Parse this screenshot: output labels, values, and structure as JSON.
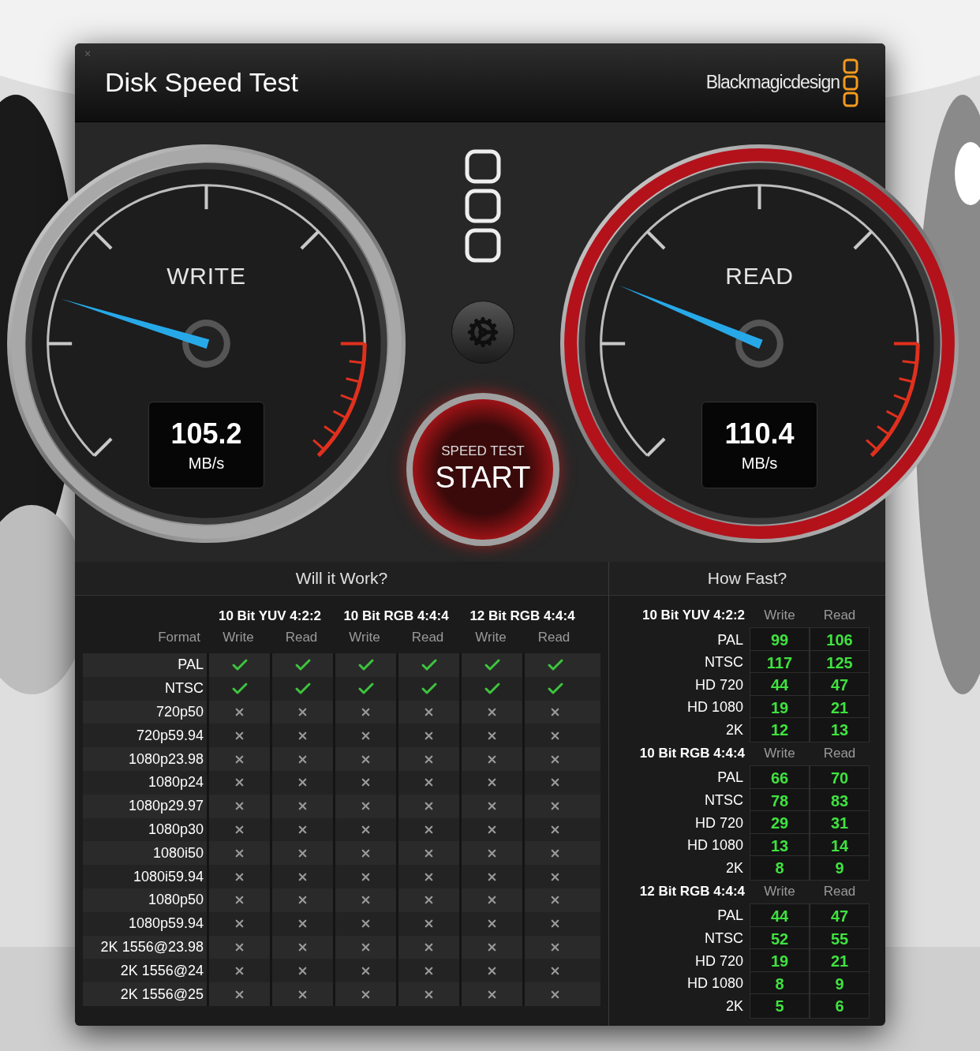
{
  "window": {
    "close": "×",
    "title": "Disk Speed Test",
    "brand": "Blackmagicdesign"
  },
  "gauges": [
    {
      "label": "WRITE",
      "value": "105.2",
      "unit": "MB/s",
      "level": 0.23,
      "color": "#a8a8a8"
    },
    {
      "label": "READ",
      "value": "110.4",
      "unit": "MB/s",
      "level": 0.25,
      "color": "#b3121b"
    }
  ],
  "start_button": {
    "caption": "SPEED TEST",
    "label": "START"
  },
  "will_it_work": {
    "title": "Will it Work?",
    "groups": [
      "10 Bit YUV 4:2:2",
      "10 Bit RGB 4:4:4",
      "12 Bit RGB 4:4:4"
    ],
    "format_header": "Format",
    "column_headers": [
      "Write",
      "Read",
      "Write",
      "Read",
      "Write",
      "Read"
    ],
    "rows": [
      {
        "format": "PAL",
        "supported": [
          true,
          true,
          true,
          true,
          true,
          true
        ]
      },
      {
        "format": "NTSC",
        "supported": [
          true,
          true,
          true,
          true,
          true,
          true
        ]
      },
      {
        "format": "720p50",
        "supported": [
          false,
          false,
          false,
          false,
          false,
          false
        ]
      },
      {
        "format": "720p59.94",
        "supported": [
          false,
          false,
          false,
          false,
          false,
          false
        ]
      },
      {
        "format": "1080p23.98",
        "supported": [
          false,
          false,
          false,
          false,
          false,
          false
        ]
      },
      {
        "format": "1080p24",
        "supported": [
          false,
          false,
          false,
          false,
          false,
          false
        ]
      },
      {
        "format": "1080p29.97",
        "supported": [
          false,
          false,
          false,
          false,
          false,
          false
        ]
      },
      {
        "format": "1080p30",
        "supported": [
          false,
          false,
          false,
          false,
          false,
          false
        ]
      },
      {
        "format": "1080i50",
        "supported": [
          false,
          false,
          false,
          false,
          false,
          false
        ]
      },
      {
        "format": "1080i59.94",
        "supported": [
          false,
          false,
          false,
          false,
          false,
          false
        ]
      },
      {
        "format": "1080p50",
        "supported": [
          false,
          false,
          false,
          false,
          false,
          false
        ]
      },
      {
        "format": "1080p59.94",
        "supported": [
          false,
          false,
          false,
          false,
          false,
          false
        ]
      },
      {
        "format": "2K 1556@23.98",
        "supported": [
          false,
          false,
          false,
          false,
          false,
          false
        ]
      },
      {
        "format": "2K 1556@24",
        "supported": [
          false,
          false,
          false,
          false,
          false,
          false
        ]
      },
      {
        "format": "2K 1556@25",
        "supported": [
          false,
          false,
          false,
          false,
          false,
          false
        ]
      }
    ]
  },
  "how_fast": {
    "title": "How Fast?",
    "groups": [
      {
        "name": "10 Bit YUV 4:2:2",
        "write_header": "Write",
        "read_header": "Read",
        "rows": [
          {
            "format": "PAL",
            "write": "99",
            "read": "106"
          },
          {
            "format": "NTSC",
            "write": "117",
            "read": "125"
          },
          {
            "format": "HD 720",
            "write": "44",
            "read": "47"
          },
          {
            "format": "HD 1080",
            "write": "19",
            "read": "21"
          },
          {
            "format": "2K",
            "write": "12",
            "read": "13"
          }
        ]
      },
      {
        "name": "10 Bit RGB 4:4:4",
        "write_header": "Write",
        "read_header": "Read",
        "rows": [
          {
            "format": "PAL",
            "write": "66",
            "read": "70"
          },
          {
            "format": "NTSC",
            "write": "78",
            "read": "83"
          },
          {
            "format": "HD 720",
            "write": "29",
            "read": "31"
          },
          {
            "format": "HD 1080",
            "write": "13",
            "read": "14"
          },
          {
            "format": "2K",
            "write": "8",
            "read": "9"
          }
        ]
      },
      {
        "name": "12 Bit RGB 4:4:4",
        "write_header": "Write",
        "read_header": "Read",
        "rows": [
          {
            "format": "PAL",
            "write": "44",
            "read": "47"
          },
          {
            "format": "NTSC",
            "write": "52",
            "read": "55"
          },
          {
            "format": "HD 720",
            "write": "19",
            "read": "21"
          },
          {
            "format": "HD 1080",
            "write": "8",
            "read": "9"
          },
          {
            "format": "2K",
            "write": "5",
            "read": "6"
          }
        ]
      }
    ]
  }
}
